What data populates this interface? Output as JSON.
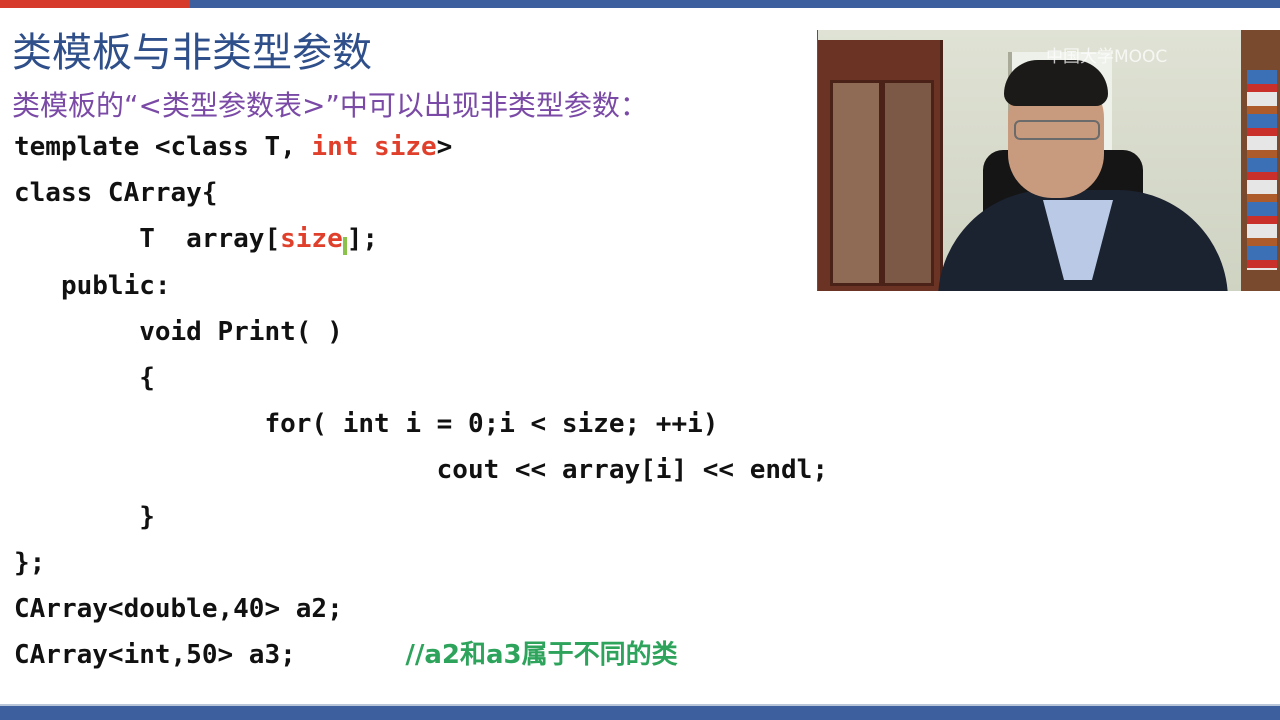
{
  "slide": {
    "title": "类模板与非类型参数",
    "subtitle": "类模板的“<类型参数表>”中可以出现非类型参数："
  },
  "code": {
    "l1_a": "template <class T, ",
    "l1_b": "int size",
    "l1_c": ">",
    "l2": "class CArray{",
    "l3_a": "        T  array[",
    "l3_b": "size",
    "l3_c": "];",
    "l4": "   public:",
    "l5": "        void Print( )",
    "l6": "        {",
    "l7": "                for( int i = 0;i < size; ++i)",
    "l8": "                           cout << array[i] << endl;",
    "l9": "        }",
    "l10": "};",
    "l11": "CArray<double,40> a2;",
    "l12_a": "CArray<int,50> a3;       ",
    "l12_b": "//a2和a3属于不同的类"
  },
  "video": {
    "watermark": "中国大学MOOC"
  },
  "colors": {
    "title": "#2f4f8a",
    "subtitle": "#7a4aa6",
    "keyword_red": "#e0402b",
    "comment_green": "#2da35b",
    "bar_blue": "#3d5f9e",
    "bar_red": "#d63a2a"
  }
}
